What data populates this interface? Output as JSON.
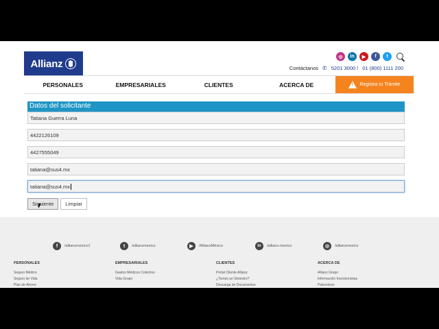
{
  "brand": {
    "name": "Allianz"
  },
  "header": {
    "contact_label": "Contáctanos",
    "phone_1": "5201 3000 /",
    "phone_2": "01 (800) 1111 200"
  },
  "social_top": [
    {
      "name": "instagram",
      "glyph": "◎",
      "color": "#c13584"
    },
    {
      "name": "linkedin",
      "glyph": "in",
      "color": "#0e76a8"
    },
    {
      "name": "youtube",
      "glyph": "▶",
      "color": "#cc181e"
    },
    {
      "name": "facebook",
      "glyph": "f",
      "color": "#3b5998"
    },
    {
      "name": "twitter",
      "glyph": "t",
      "color": "#1da1f2"
    }
  ],
  "nav": {
    "items": [
      "PERSONALES",
      "EMPRESARIALES",
      "CLIENTES",
      "ACERCA DE"
    ],
    "cta": "Registra tu Trámite"
  },
  "form": {
    "title": "Datos del solicitante",
    "fields": [
      "Tatiana Guerra Luna",
      "4422126109",
      "4427555049",
      "tatiana@sus4.mx",
      "tatiana@sus4.mx"
    ],
    "submit": "Siguiente",
    "reset": "Limpiar"
  },
  "footer": {
    "social": [
      {
        "glyph": "f",
        "handle": "/allianzmexico1"
      },
      {
        "glyph": "t",
        "handle": "/allianzmexico"
      },
      {
        "glyph": "▶",
        "handle": "/AllianzMéxico"
      },
      {
        "glyph": "in",
        "handle": "/allianz-mexico"
      },
      {
        "glyph": "◎",
        "handle": "/allianzmexico"
      }
    ],
    "columns": [
      {
        "title": "PERSONALES",
        "links": [
          "Seguro Médico",
          "Seguro de Vida",
          "Plan de Ahorro"
        ]
      },
      {
        "title": "EMPRESARIALES",
        "links": [
          "Gastos Médicos Colectivo",
          "Vida Grupo"
        ]
      },
      {
        "title": "CLIENTES",
        "links": [
          "Portal Cliente Allianz",
          "¿Tienes un Siniestro?",
          "Descarga de Documentos"
        ]
      },
      {
        "title": "ACERCA DE",
        "links": [
          "Allianz Grupo",
          "Información Inversionistas",
          "Patrocinios"
        ]
      }
    ]
  }
}
